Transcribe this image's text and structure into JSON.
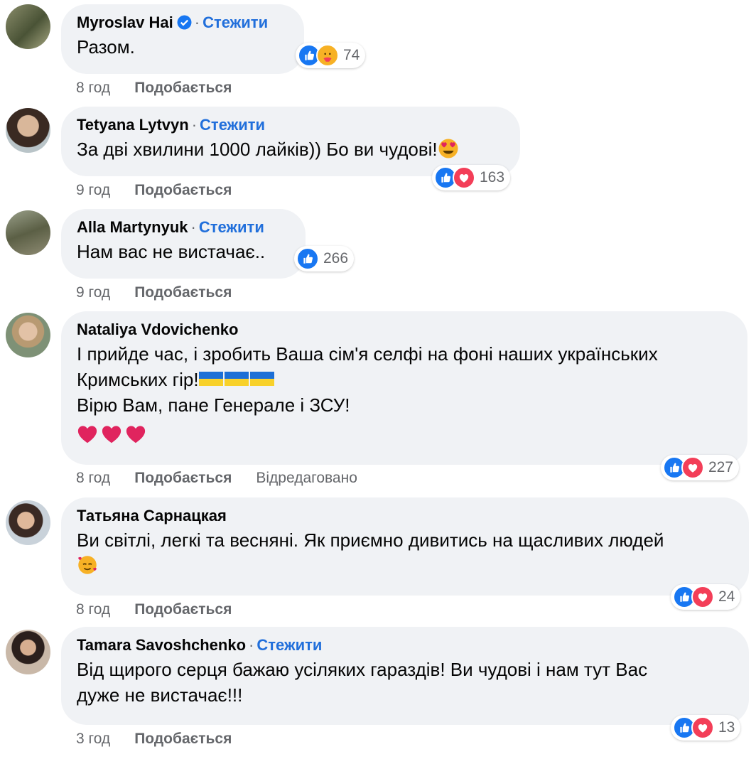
{
  "comments": [
    {
      "author": "Myroslav Hai",
      "verified": true,
      "follow": "Стежити",
      "lines": [
        "Разом."
      ],
      "time": "8 год",
      "like_label": "Подобається",
      "edited": "",
      "reactions": [
        "like",
        "care"
      ],
      "reaction_count": "74"
    },
    {
      "author": "Tetyana Lytvyn",
      "verified": false,
      "follow": "Стежити",
      "lines": [
        "За дві хвилини 1000 лайків)) Бо ви чудові!"
      ],
      "trailing_emoji": "heart-eyes-emoji",
      "time": "9 год",
      "like_label": "Подобається",
      "edited": "",
      "reactions": [
        "like",
        "love"
      ],
      "reaction_count": "163"
    },
    {
      "author": "Alla Martynyuk",
      "verified": false,
      "follow": "Стежити",
      "lines": [
        "Нам вас не вистачає.."
      ],
      "time": "9 год",
      "like_label": "Подобається",
      "edited": "",
      "reactions": [
        "like"
      ],
      "reaction_count": "266"
    },
    {
      "author": "Nataliya Vdovichenko",
      "verified": false,
      "follow": "",
      "lines": [
        "І прийде час, і зробить Ваша сім'я селфі на фоні наших українських",
        "Кримських гір!",
        "Вірю Вам, пане Генерале і ЗСУ!"
      ],
      "flags_count": 3,
      "hearts_count": 3,
      "time": "8 год",
      "like_label": "Подобається",
      "edited": "Відредаговано",
      "reactions": [
        "like",
        "love"
      ],
      "reaction_count": "227"
    },
    {
      "author": "Татьяна Сарнацкая",
      "verified": false,
      "follow": "",
      "lines": [
        "Ви світлі, легкі та весняні. Як приємно дивитись на щасливих людей"
      ],
      "second_line_emoji": "smiling-hearts-emoji",
      "time": "8 год",
      "like_label": "Подобається",
      "edited": "",
      "reactions": [
        "like",
        "love"
      ],
      "reaction_count": "24"
    },
    {
      "author": "Tamara Savoshchenko",
      "verified": false,
      "follow": "Стежити",
      "lines": [
        "Від щирого серця бажаю усіляких гараздів! Ви чудові і нам тут Вас",
        "дуже не вистачає!!!"
      ],
      "time": "3 год",
      "like_label": "Подобається",
      "edited": "",
      "reactions": [
        "like",
        "love"
      ],
      "reaction_count": "13"
    }
  ],
  "colors": {
    "bubble_bg": "#f0f2f5",
    "follow_link": "#216fdb",
    "meta_text": "#65676b",
    "like_reaction": "#1877f2",
    "love_reaction": "#f33e58"
  }
}
